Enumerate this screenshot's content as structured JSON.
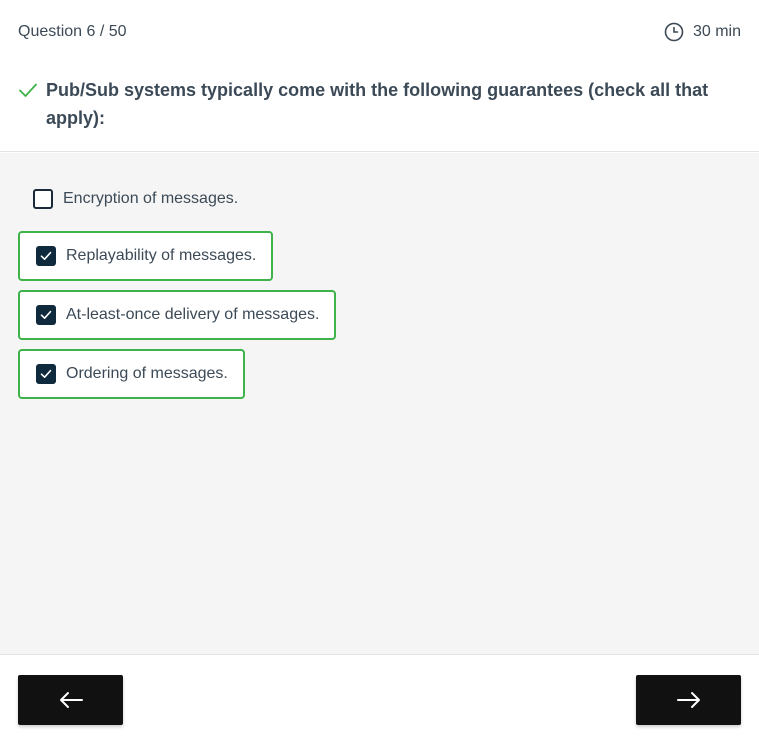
{
  "header": {
    "question_counter": "Question 6 / 50",
    "timer_label": "30 min",
    "question_text": "Pub/Sub systems typically come with the following guarantees (check all that apply):"
  },
  "options": [
    {
      "label": "Encryption of messages.",
      "checked": false
    },
    {
      "label": "Replayability of messages.",
      "checked": true
    },
    {
      "label": "At-least-once delivery of messages.",
      "checked": true
    },
    {
      "label": "Ordering of messages.",
      "checked": true
    }
  ],
  "colors": {
    "accent_green": "#3fb24a",
    "checkbox_dark": "#0f2a3d",
    "button_black": "#111111",
    "text": "#3c4a57"
  },
  "icons": {
    "timer": "clock-icon",
    "question_status": "checkmark-icon",
    "back": "arrow-left-icon",
    "next": "arrow-right-icon"
  }
}
